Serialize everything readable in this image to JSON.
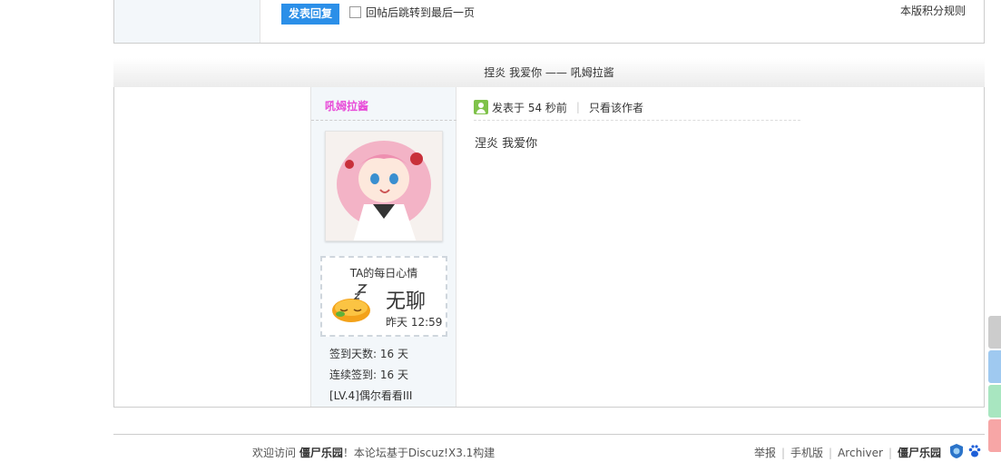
{
  "reply": {
    "button_label": "发表回复",
    "jump_label": "回帖后跳转到最后一页",
    "rules_link": "本版积分规则"
  },
  "thread": {
    "title": "捏炎 我爱你 —— 吼姆拉酱"
  },
  "post": {
    "author": "吼姆拉酱",
    "mood_title": "TA的每日心情",
    "mood": "无聊",
    "mood_time": "昨天 12:59",
    "checkin_days": "签到天数: 16 天",
    "continuous_checkin": "连续签到: 16 天",
    "level": "[LV.4]偶尔看看III",
    "posted_time": "发表于 54 秒前",
    "only_author": "只看该作者",
    "content": "涅炎  我爱你"
  },
  "footer": {
    "welcome_prefix": "欢迎访问 ",
    "site_name": "僵尸乐园",
    "welcome_suffix": "！本论坛基于Discuz!X3.1构建",
    "report": "举报",
    "mobile": "手机版",
    "archiver": "Archiver",
    "site_name_right": "僵尸乐园"
  },
  "colors": {
    "author_name": "#e84bd8",
    "reply_button": "#2b8fe8",
    "float_tabs": [
      "#cccccc",
      "#9fc9f0",
      "#a8e6c0",
      "#f7a6a6"
    ]
  }
}
